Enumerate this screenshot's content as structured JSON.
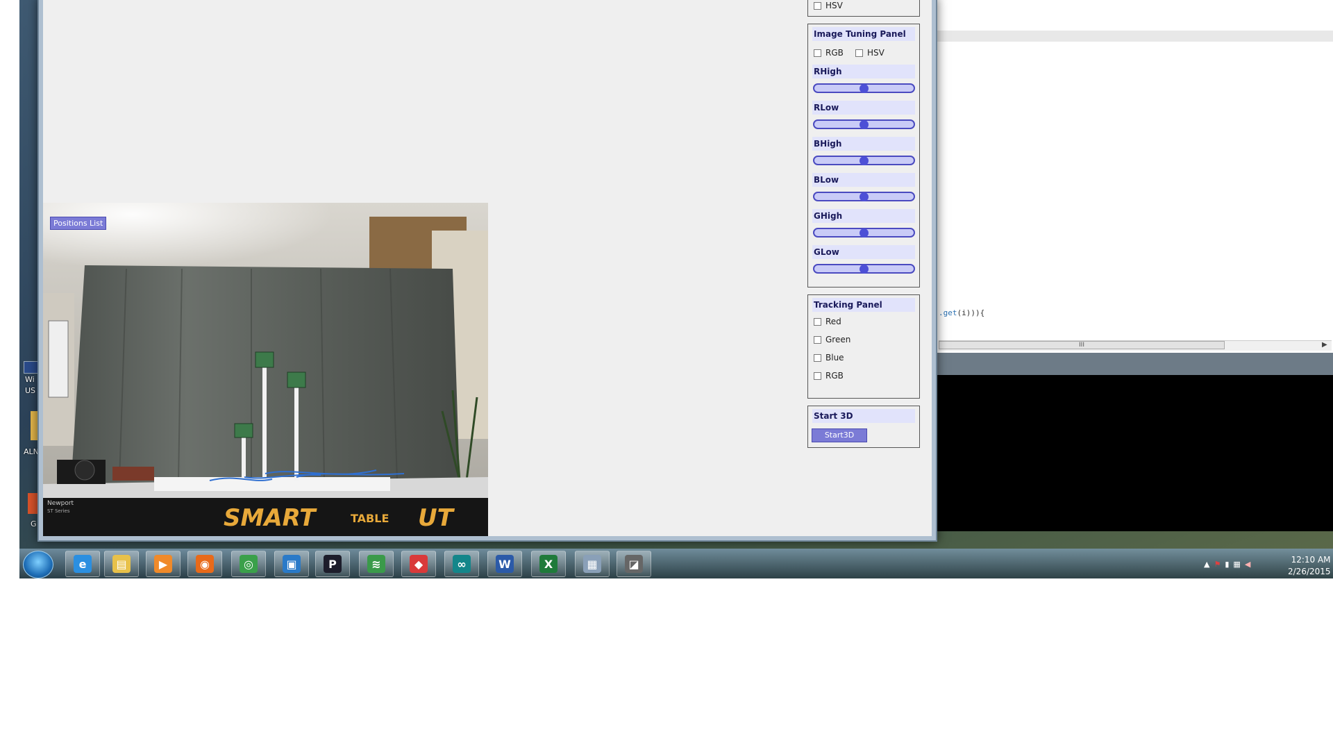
{
  "editor": {
    "code_line_prefix": "",
    "code_line_method": ".get",
    "code_line_rest": "(i))){",
    "scroll_thumb_label": "III"
  },
  "desktop_icons": [
    {
      "label": "Wi\nUS",
      "icon": "usb-icon"
    },
    {
      "label": "ALN",
      "icon": "folder-icon"
    },
    {
      "label": "G",
      "icon": "app-icon"
    }
  ],
  "camera": {
    "positions_list_label": "Positions List",
    "table_brand": "SMART",
    "table_sub": "TABLE",
    "table_model": "UT",
    "table_maker": "Newport",
    "table_series": "ST Series"
  },
  "top_panel": {
    "hsv_label": "HSV"
  },
  "image_tuning": {
    "title": "Image Tuning Panel",
    "rgb_label": "RGB",
    "hsv_label": "HSV",
    "sliders": [
      {
        "label": "RHigh",
        "value": 0.5
      },
      {
        "label": "RLow",
        "value": 0.5
      },
      {
        "label": "BHigh",
        "value": 0.5
      },
      {
        "label": "BLow",
        "value": 0.5
      },
      {
        "label": "GHigh",
        "value": 0.5
      },
      {
        "label": "GLow",
        "value": 0.5
      }
    ]
  },
  "tracking": {
    "title": "Tracking Panel",
    "options": [
      "Red",
      "Green",
      "Blue",
      "RGB"
    ]
  },
  "start3d": {
    "title": "Start 3D",
    "button_label": "Start3D"
  },
  "taskbar": {
    "items": [
      {
        "name": "internet-explorer-icon",
        "glyph": "e",
        "color": "#2b8fe0"
      },
      {
        "name": "file-explorer-icon",
        "glyph": "▤",
        "color": "#e8c14a"
      },
      {
        "name": "media-player-icon",
        "glyph": "▶",
        "color": "#f08a2a"
      },
      {
        "name": "firefox-icon",
        "glyph": "◉",
        "color": "#e86a1a"
      },
      {
        "name": "chrome-icon",
        "glyph": "◎",
        "color": "#3aa04a"
      },
      {
        "name": "virtualbox-icon",
        "glyph": "▣",
        "color": "#2a7ac8"
      },
      {
        "name": "processing-icon",
        "glyph": "P",
        "color": "#1d1d2b"
      },
      {
        "name": "wireless-app-icon",
        "glyph": "≋",
        "color": "#3a9a4a"
      },
      {
        "name": "git-app-icon",
        "glyph": "◆",
        "color": "#d93a3a"
      },
      {
        "name": "arduino-icon",
        "glyph": "∞",
        "color": "#13868a"
      },
      {
        "name": "word-icon",
        "glyph": "W",
        "color": "#2b5aa8"
      },
      {
        "name": "excel-icon",
        "glyph": "X",
        "color": "#1f7a3a"
      },
      {
        "name": "calculator-icon",
        "glyph": "▦",
        "color": "#8aa0b8"
      },
      {
        "name": "java-app-icon",
        "glyph": "◪",
        "color": "#666666"
      }
    ],
    "time": "12:10 AM",
    "date": "2/26/2015"
  }
}
